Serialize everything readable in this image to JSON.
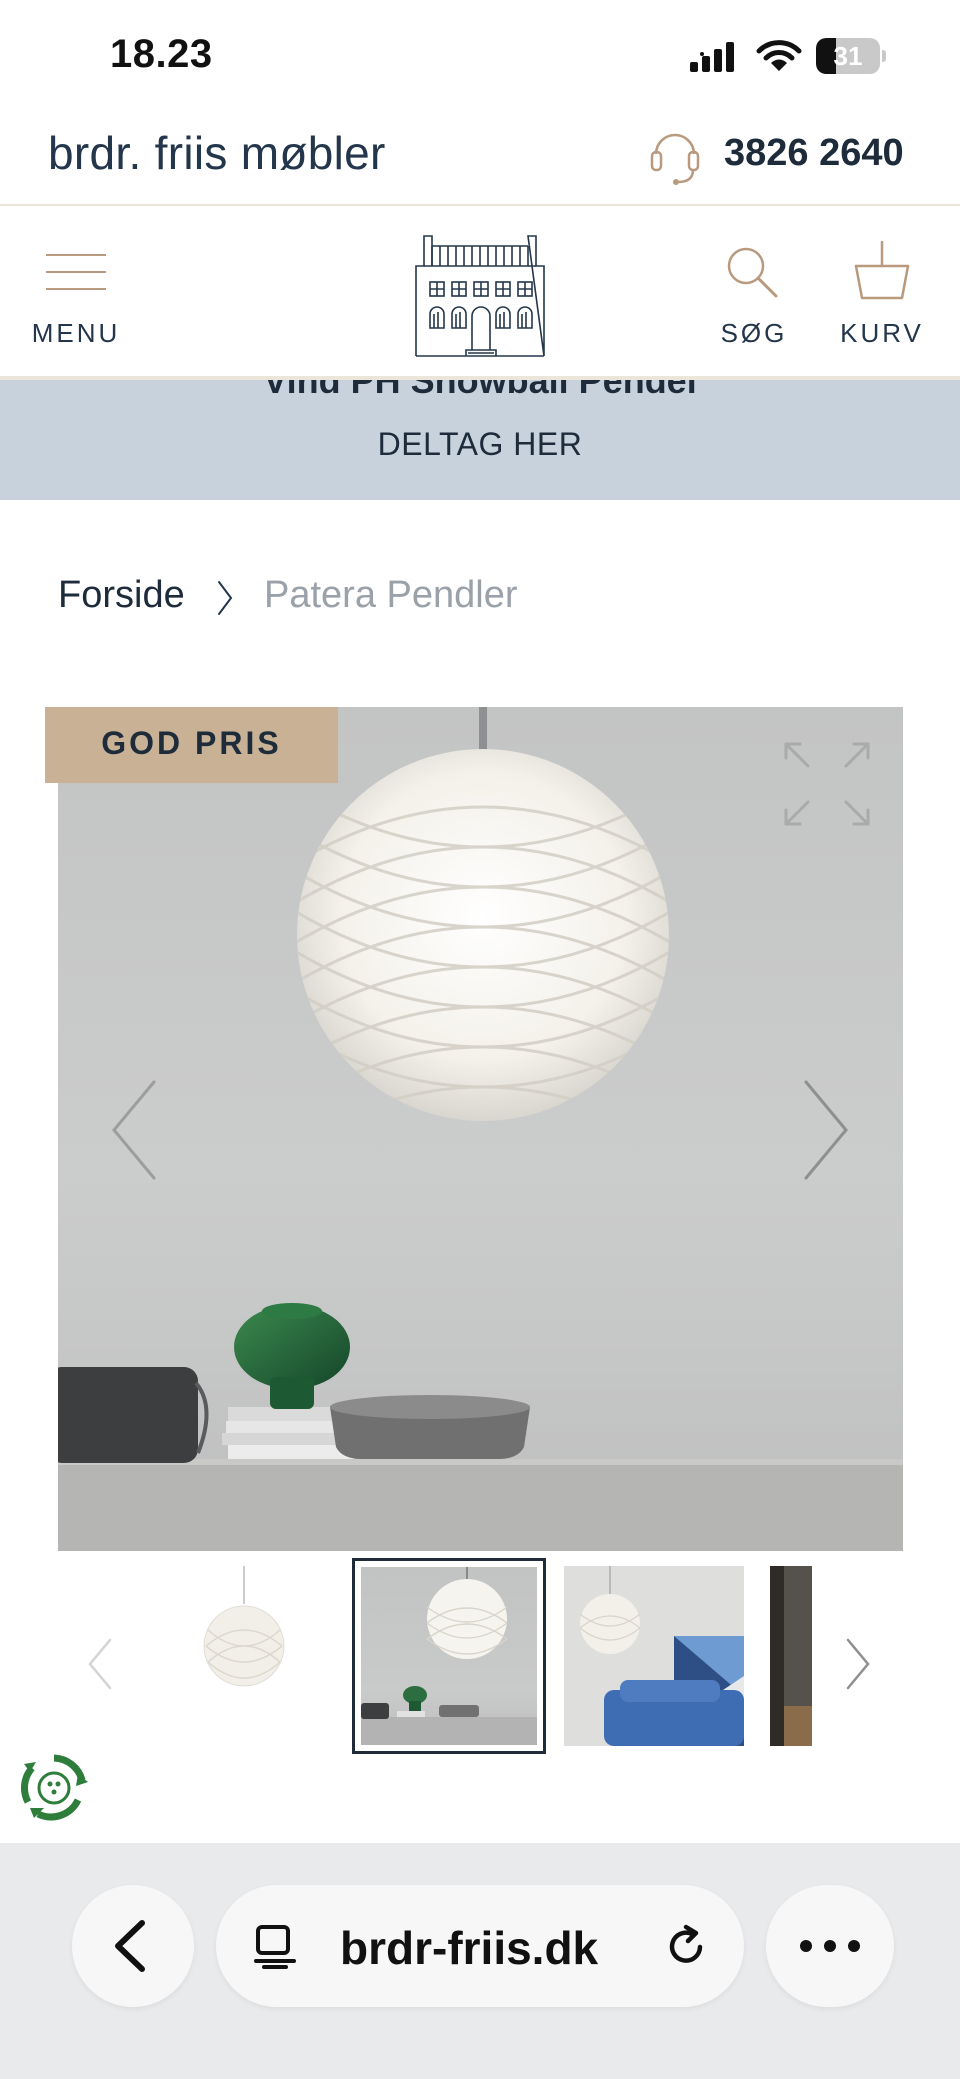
{
  "status_bar": {
    "time": "18.23",
    "battery_percent": "31",
    "battery_level": 0.31
  },
  "brand": {
    "name": "brdr. friis møbler",
    "phone": "3826 2640"
  },
  "nav": {
    "menu_label": "MENU",
    "search_label": "SØG",
    "cart_label": "KURV",
    "accent_color": "#b99a7f"
  },
  "promo": {
    "title": "Vind PH Snowball Pendel",
    "link": "DELTAG HER",
    "background": "#c8d2dc"
  },
  "breadcrumb": {
    "home": "Forside",
    "current": "Patera Pendler"
  },
  "product": {
    "badge": "GOD PRIS",
    "badge_color": "#c9b196",
    "thumbnail_count_visible": 4,
    "selected_thumbnail": 2
  },
  "browser": {
    "url": "brdr-friis.dk"
  }
}
